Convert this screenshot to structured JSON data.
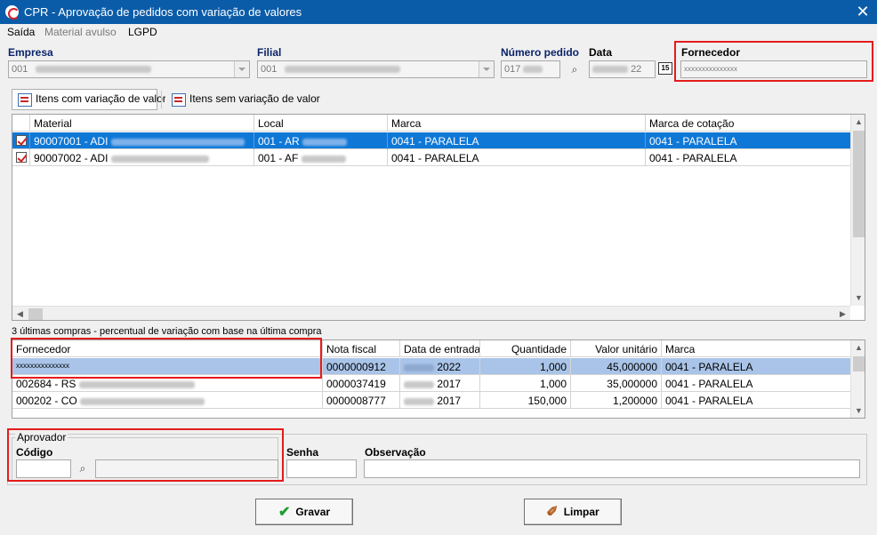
{
  "window": {
    "title": "CPR - Aprovação de pedidos com variação de valores"
  },
  "menu": [
    {
      "label": "Saída"
    },
    {
      "label": "Material avulso"
    },
    {
      "label": "LGPD"
    }
  ],
  "header": {
    "empresa_label": "Empresa",
    "empresa_value": "001",
    "filial_label": "Filial",
    "filial_value": "001",
    "numero_label": "Número pedido",
    "numero_value": "017",
    "data_label": "Data",
    "data_value": "22",
    "fornecedor_label": "Fornecedor",
    "fornecedor_value": "xxxxxxxxxxxxxxx"
  },
  "tabs": [
    {
      "label": "Itens com variação de valor",
      "active": true
    },
    {
      "label": "Itens sem variação de valor",
      "active": false
    }
  ],
  "items_grid": {
    "columns": [
      "Material",
      "Local",
      "Marca",
      "Marca de cotação"
    ],
    "rows": [
      {
        "material": "90007001 - ADI",
        "local": "001 - AR",
        "marca": "0041 - PARALELA",
        "marca_cotacao": "0041 - PARALELA",
        "checked": true
      },
      {
        "material": "90007002 - ADI",
        "local": "001 - AF",
        "marca": "0041 - PARALELA",
        "marca_cotacao": "0041 - PARALELA",
        "checked": true
      }
    ]
  },
  "history": {
    "caption": "3 últimas compras - percentual de variação com base na última compra",
    "columns": [
      "Fornecedor",
      "Nota fiscal",
      "Data de entrada",
      "Quantidade",
      "Valor unitário",
      "Marca"
    ],
    "rows": [
      {
        "fornecedor": "xxxxxxxxxxxxxxx",
        "nota": "0000000912",
        "data": "2022",
        "qtd": "1,000",
        "valor": "45,000000",
        "marca": "0041 - PARALELA"
      },
      {
        "fornecedor": "002684 - RS",
        "nota": "0000037419",
        "data": "2017",
        "qtd": "1,000",
        "valor": "35,000000",
        "marca": "0041 - PARALELA"
      },
      {
        "fornecedor": "000202 - CO",
        "nota": "0000008777",
        "data": "2017",
        "qtd": "150,000",
        "valor": "1,200000",
        "marca": "0041 - PARALELA"
      }
    ]
  },
  "aprovador": {
    "group_title": "Aprovador",
    "codigo_label": "Código",
    "senha_label": "Senha",
    "observacao_label": "Observação"
  },
  "buttons": {
    "gravar": "Gravar",
    "limpar": "Limpar"
  },
  "colors": {
    "titlebar": "#0b5ca8",
    "selection": "#0f78d7",
    "highlight_box": "#e51b1b"
  }
}
